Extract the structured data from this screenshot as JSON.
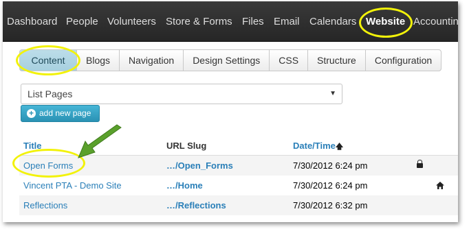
{
  "topnav": {
    "items": [
      "Dashboard",
      "People",
      "Volunteers",
      "Store & Forms",
      "Files",
      "Email",
      "Calendars",
      "Website",
      "Accountin"
    ],
    "active": "Website"
  },
  "tabs": [
    "Content",
    "Blogs",
    "Navigation",
    "Design Settings",
    "CSS",
    "Structure",
    "Configuration"
  ],
  "active_tab": "Content",
  "page_select": {
    "value": "List Pages"
  },
  "add_button": {
    "label": "add new page"
  },
  "table": {
    "headers": {
      "title": "Title",
      "slug": "URL Slug",
      "datetime": "Date/Time"
    },
    "rows": [
      {
        "title": "Open Forms",
        "slug_prefix": "…/",
        "slug": "Open_Forms",
        "datetime": "7/30/2012 6:24 pm",
        "icon": "lock-icon"
      },
      {
        "title": "Vincent PTA - Demo Site",
        "slug_prefix": "…/",
        "slug": "Home",
        "datetime": "7/30/2012 6:24 pm",
        "icon": "home-icon"
      },
      {
        "title": "Reflections",
        "slug_prefix": "…/",
        "slug": "Reflections",
        "datetime": "7/30/2012 6:32 pm",
        "icon": ""
      }
    ]
  },
  "colors": {
    "nav_bg": "#2e2e2e",
    "highlight": "#f2f20a",
    "link": "#2a7fb8",
    "accent_button": "#2a92b4",
    "arrow": "#5aa02c"
  }
}
